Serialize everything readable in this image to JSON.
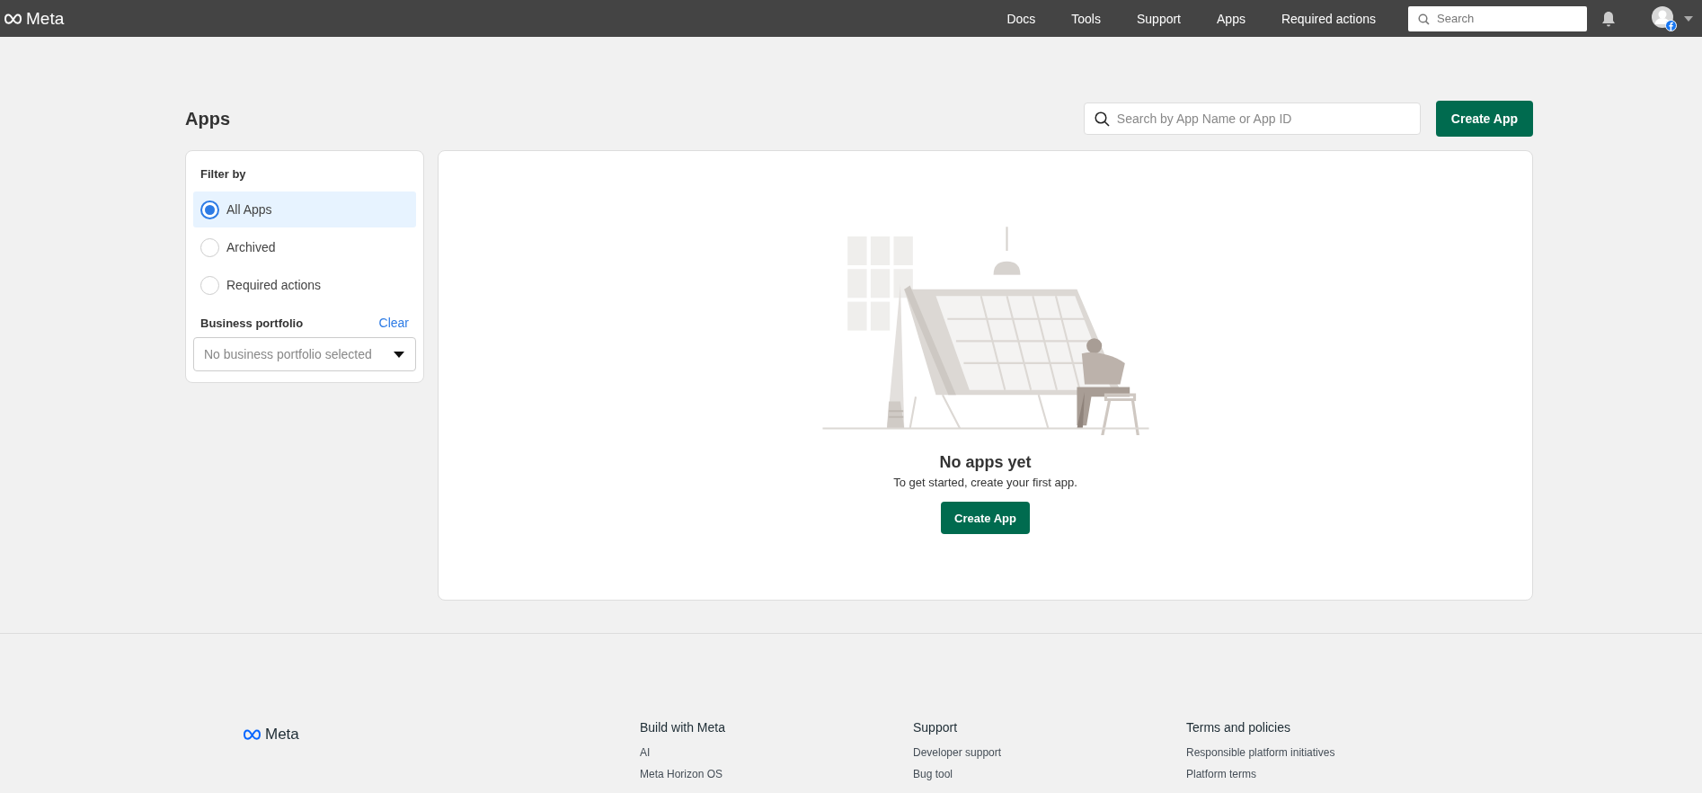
{
  "top_bar": {
    "logo_text": "Meta",
    "nav_items": [
      {
        "label": "Docs"
      },
      {
        "label": "Tools"
      },
      {
        "label": "Support"
      },
      {
        "label": "Apps"
      },
      {
        "label": "Required actions"
      }
    ],
    "search": {
      "placeholder": "Search"
    }
  },
  "page": {
    "title": "Apps",
    "search": {
      "placeholder": "Search by App Name or App ID"
    },
    "create_button": "Create App"
  },
  "filter_panel": {
    "heading": "Filter by",
    "options": [
      {
        "label": "All Apps",
        "selected": true
      },
      {
        "label": "Archived",
        "selected": false
      },
      {
        "label": "Required actions",
        "selected": false
      }
    ],
    "portfolio_label": "Business portfolio",
    "clear_link": "Clear",
    "portfolio_dropdown": {
      "placeholder": "No business portfolio selected"
    }
  },
  "empty_state": {
    "title": "No apps yet",
    "message": "To get started, create your first app.",
    "button": "Create App"
  },
  "footer": {
    "logo_text": "Meta",
    "columns": [
      {
        "heading": "Build with Meta",
        "links": [
          "AI",
          "Meta Horizon OS"
        ]
      },
      {
        "heading": "Support",
        "links": [
          "Developer support",
          "Bug tool"
        ]
      },
      {
        "heading": "Terms and policies",
        "links": [
          "Responsible platform initiatives",
          "Platform terms"
        ]
      }
    ]
  }
}
